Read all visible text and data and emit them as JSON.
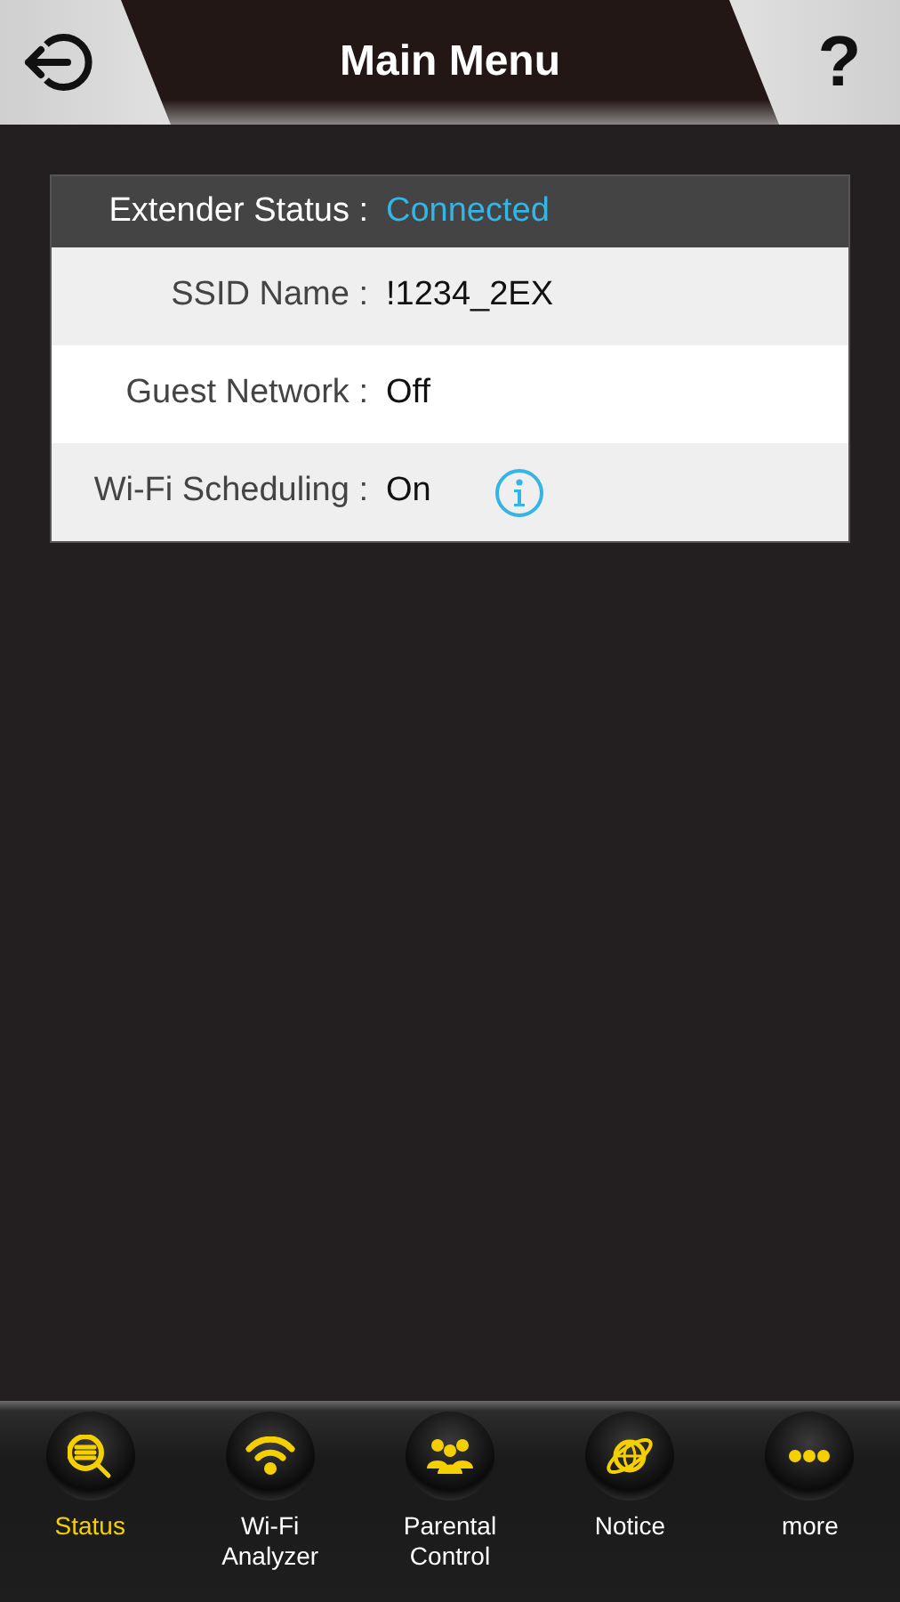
{
  "header": {
    "title": "Main Menu",
    "help": "?"
  },
  "status_table": [
    {
      "kind": "header",
      "label": "Extender Status :",
      "value": "Connected",
      "info": false
    },
    {
      "kind": "row",
      "label": "SSID Name :",
      "value": "!1234_2EX",
      "info": false
    },
    {
      "kind": "row",
      "label": "Guest Network :",
      "value": "Off",
      "info": false
    },
    {
      "kind": "row",
      "label": "Wi-Fi Scheduling :",
      "value": "On",
      "info": true
    }
  ],
  "bottom_nav": [
    {
      "kind": "status",
      "label": "Status",
      "selected": true
    },
    {
      "kind": "wifi",
      "label": "Wi-Fi\nAnalyzer",
      "selected": false
    },
    {
      "kind": "parental",
      "label": "Parental\nControl",
      "selected": false
    },
    {
      "kind": "notice",
      "label": "Notice",
      "selected": false
    },
    {
      "kind": "more",
      "label": "more",
      "selected": false
    }
  ]
}
